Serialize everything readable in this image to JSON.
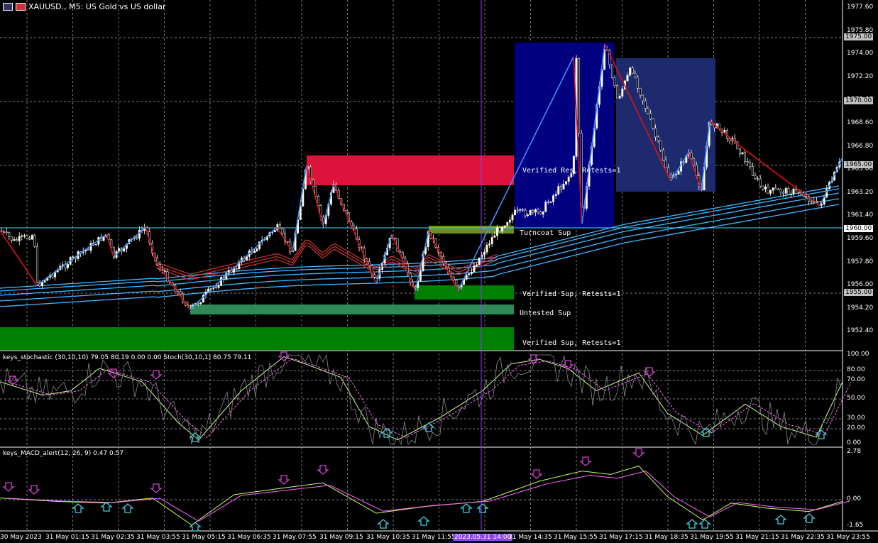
{
  "header": {
    "symbol": "XAUUSD.",
    "timeframe": "M5",
    "description": "US Gold vs US dollar",
    "title": "XAUUSD., M5:  US Gold vs US dollar"
  },
  "price_axis": {
    "ticks": [
      "1977.60",
      "1975.80",
      "1974.00",
      "1972.20",
      "1970.40",
      "1968.60",
      "1966.80",
      "1965.00",
      "1963.20",
      "1961.40",
      "1959.60",
      "1957.80",
      "1956.00",
      "1954.20",
      "1952.40"
    ],
    "tags": [
      "1975.00",
      "1970.00",
      "1965.00",
      "1960.00",
      "1955.00"
    ]
  },
  "zones": [
    {
      "label": "Verified Res, Retests=1",
      "color": "#dc143c"
    },
    {
      "label": "Turncoat Sup",
      "color": "#6b8e23"
    },
    {
      "label": "Verified Sup, Retests=1",
      "color": "#008000"
    },
    {
      "label": "Untested Sup",
      "color": "#2e8b57"
    },
    {
      "label": "Verified Sup, Retests=1",
      "color": "#008000"
    }
  ],
  "stoch": {
    "label": "keys_stochastic (30,10,10) 79.05 80.19 0.00 0.00 Stoch(30,10,1) 80.75 79.11",
    "ticks": [
      "100.00",
      "80.00",
      "70.00",
      "50.00",
      "30.00",
      "20.00",
      "0.00"
    ]
  },
  "macd": {
    "label": "keys_MACD_alert(12, 26, 9) 0.47 0.57",
    "ticks": [
      "2.78",
      "0.00",
      "-1.65"
    ]
  },
  "time_axis": [
    "30 May 2023",
    "31 May 01:15",
    "31 May 02:35",
    "31 May 03:55",
    "31 May 05:15",
    "31 May 06:35",
    "31 May 07:55",
    "31 May 09:15",
    "31 May 10:35",
    "31 May 11:55",
    "2023.05.31 14:00",
    "31 May 14:35",
    "31 May 15:55",
    "31 May 17:15",
    "31 May 18:35",
    "31 May 19:55",
    "31 May 21:15",
    "31 May 22:35",
    "31 May 23:55"
  ],
  "colors": {
    "bg": "#000000",
    "bull": "#ffffff",
    "bear": "#ffffff",
    "ma": "#3fb6ff",
    "ma_red": "#c03030",
    "zig_up": "#3f8fff",
    "zig_down": "#e01010",
    "box1": "#000080",
    "box2": "#1e2a6e",
    "cursor": "#9040ff"
  }
}
